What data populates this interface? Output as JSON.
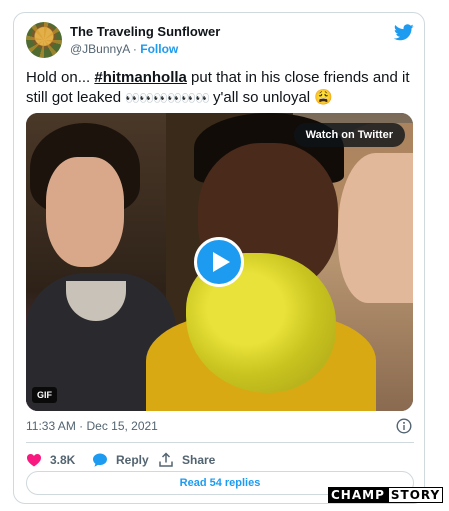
{
  "tweet": {
    "author_name": "The Traveling Sunflower",
    "handle": "@JBunnyA",
    "separator": " · ",
    "follow_label": "Follow",
    "text_prefix": "Hold on... ",
    "hashtag": "#hitmanholla",
    "text_suffix": " put that in his close friends and it still got leaked ",
    "eyes": "👀👀👀👀👀👀",
    "text_end": " y'all so unloyal ",
    "emoji": "😩",
    "timestamp": "11:33 AM · Dec 15, 2021"
  },
  "media": {
    "watch_label": "Watch on Twitter",
    "badge": "GIF"
  },
  "actions": {
    "likes": "3.8K",
    "reply_label": "Reply",
    "share_label": "Share",
    "read_replies_label": "Read 54 replies"
  },
  "watermark": {
    "part1": "CHAMP",
    "part2": "STORY"
  },
  "colors": {
    "accent": "#1d9bf0",
    "like": "#f91880",
    "text": "#0f1419",
    "muted": "#536471",
    "border": "#cfd9de"
  },
  "icons": {
    "logo": "twitter-bird-icon",
    "like": "heart-icon",
    "reply": "speech-bubble-icon",
    "share": "share-upload-icon",
    "info": "info-icon",
    "play": "play-icon"
  }
}
